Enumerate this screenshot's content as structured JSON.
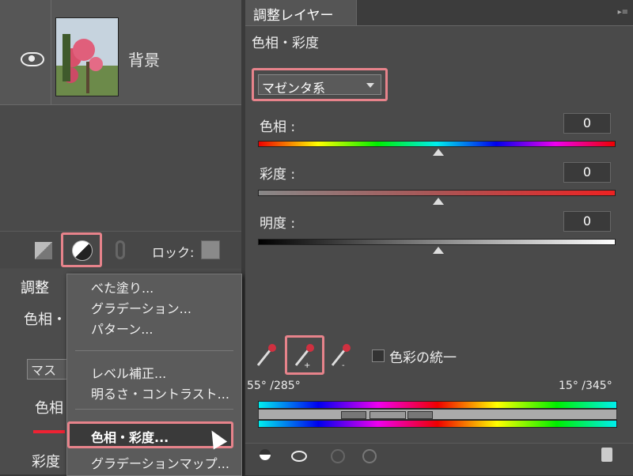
{
  "left_panel": {
    "layer_name": "背景",
    "lock_label": "ロック:",
    "adjust_tab": "調整",
    "adjust_sub": "色相・",
    "mask_label": "マス",
    "hue_label": "色相",
    "sat_label": "彩度"
  },
  "menu": {
    "items": [
      "べた塗り...",
      "グラデーション...",
      "パターン...",
      "レベル補正...",
      "明るさ・コントラスト...",
      "色相・彩度...",
      "グラデーションマップ..."
    ],
    "selected_index": 5
  },
  "adjust_panel": {
    "tab_title": "調整レイヤー",
    "subtitle": "色相・彩度",
    "dropdown_value": "マゼンタ系",
    "hue": {
      "label": "色相 :",
      "value": "0"
    },
    "saturation": {
      "label": "彩度 :",
      "value": "0"
    },
    "lightness": {
      "label": "明度 :",
      "value": "0"
    },
    "colorize_label": "色彩の統一",
    "range_left": "55° /285°",
    "range_right": "15° /345°"
  },
  "colors": {
    "highlight": "#e7838b",
    "panel_bg": "#4a4a4a"
  }
}
